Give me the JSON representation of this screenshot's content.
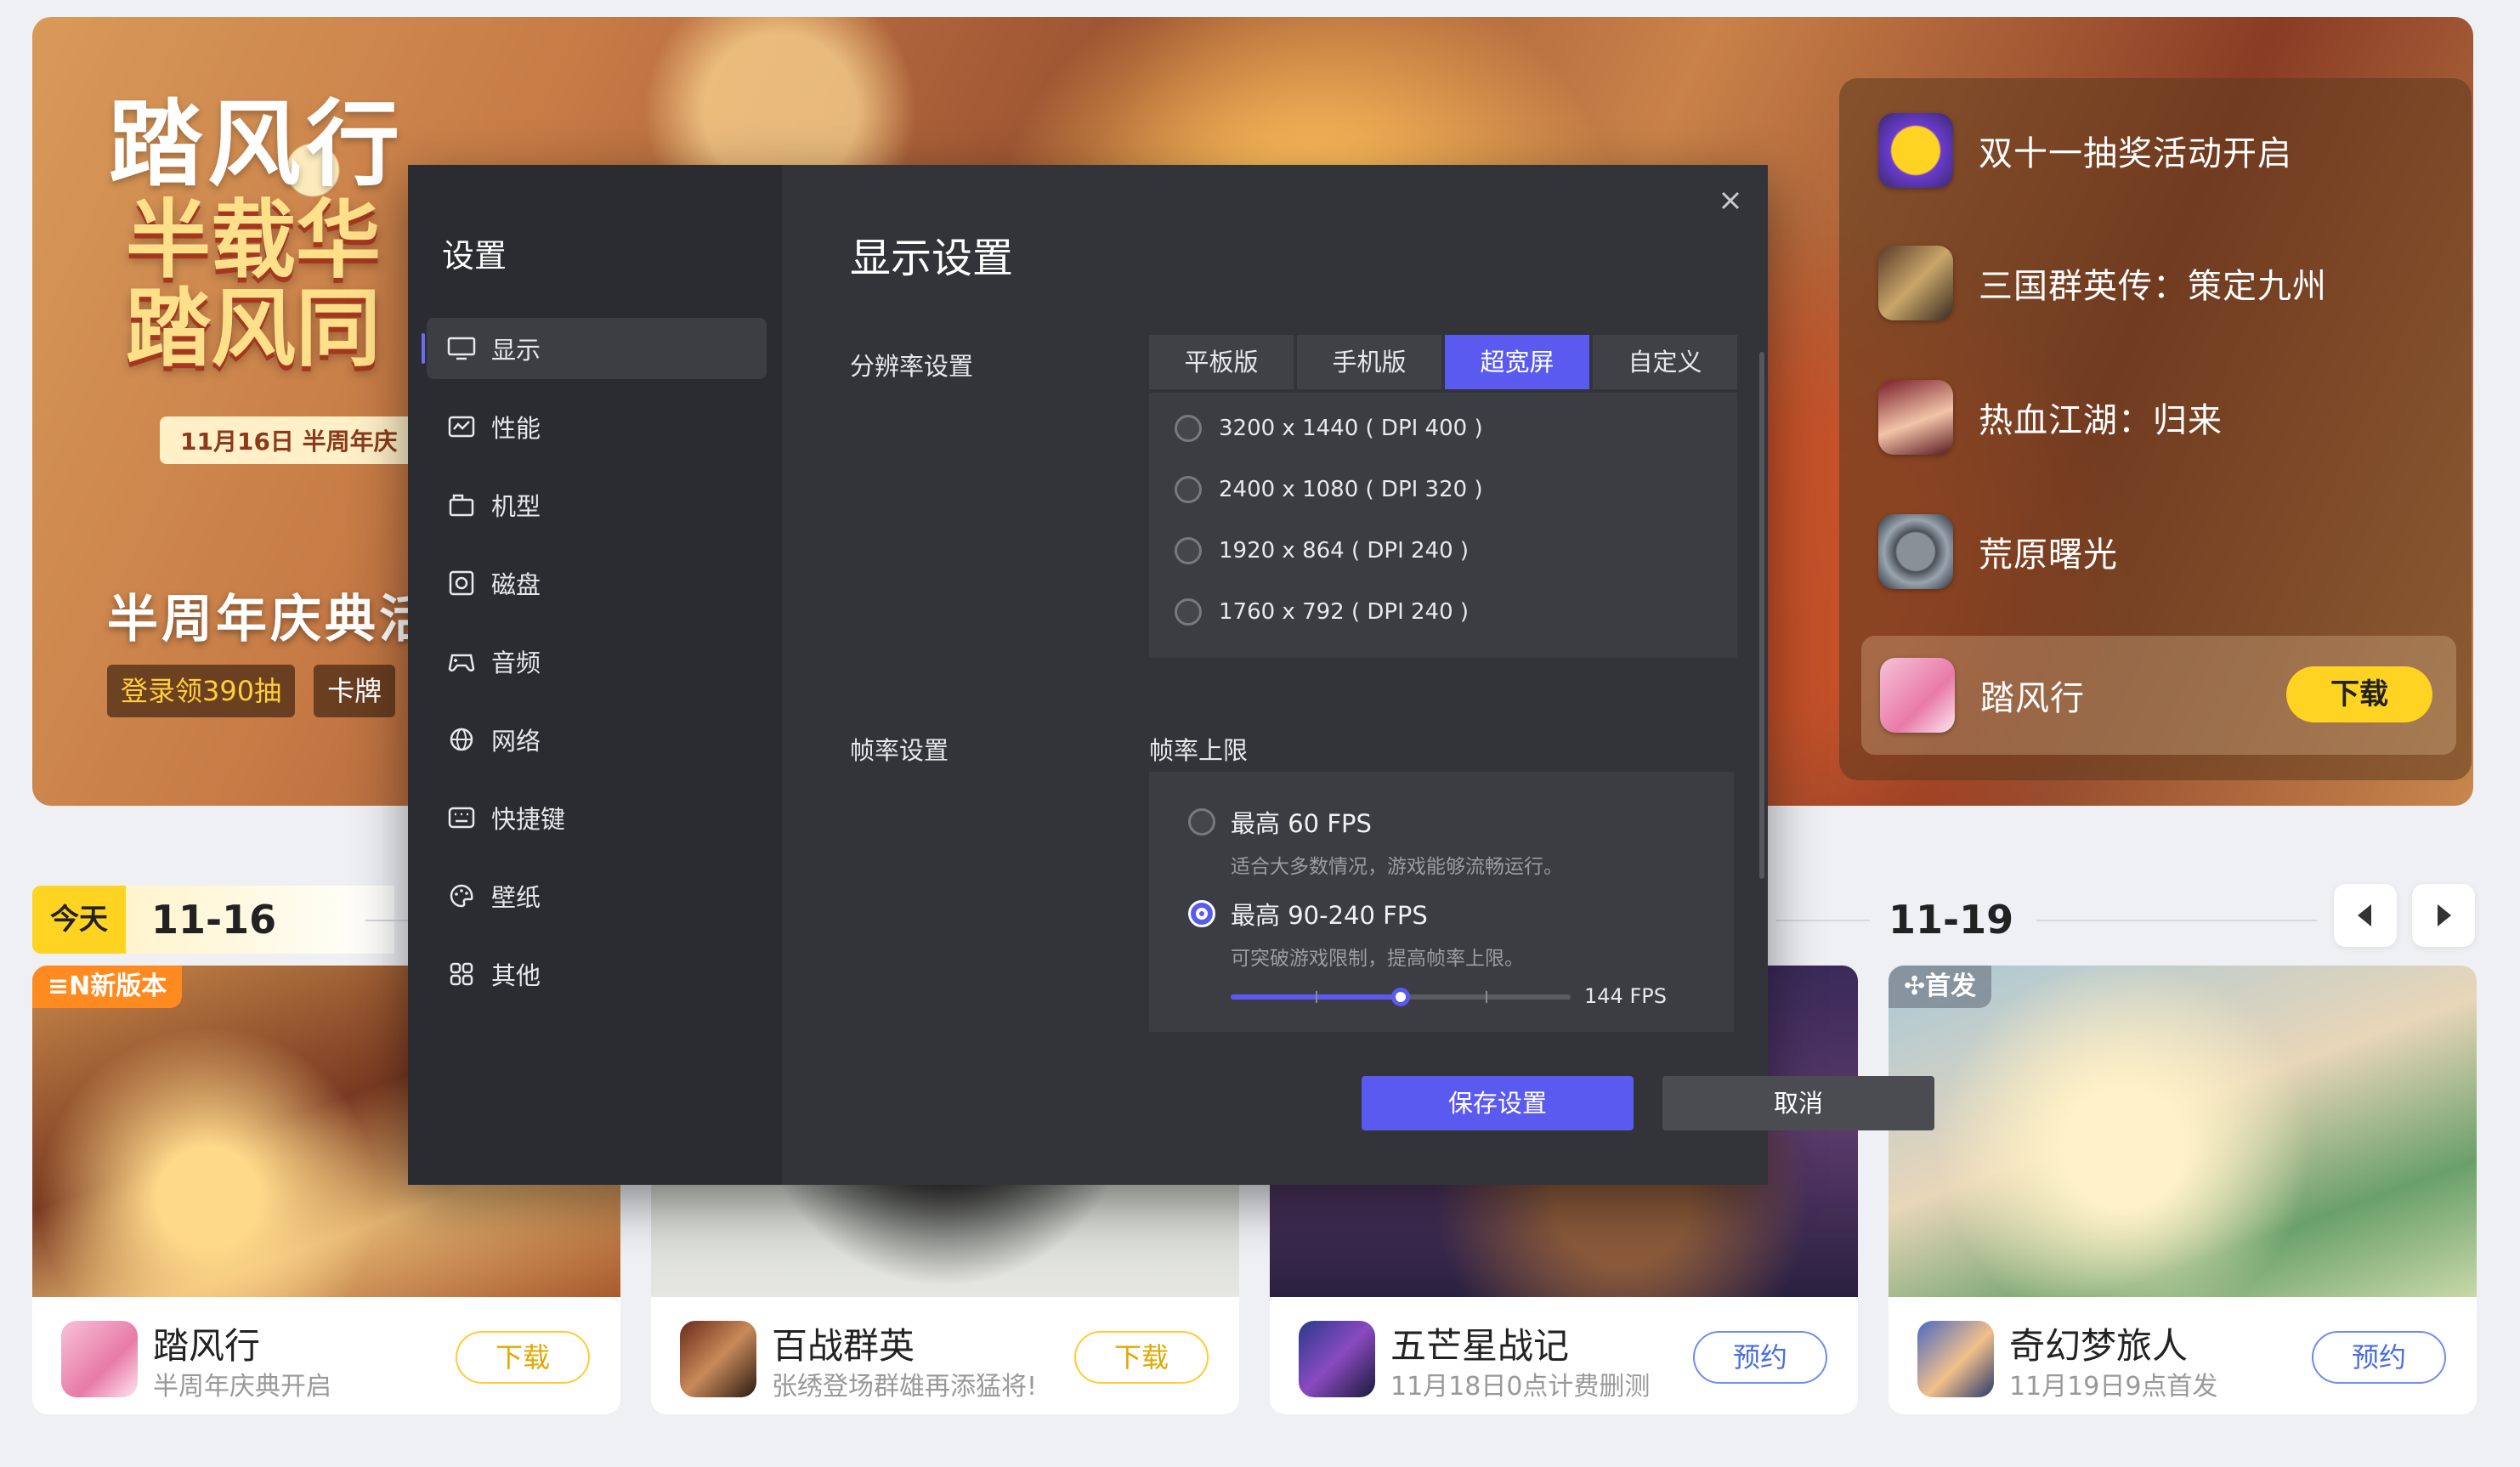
{
  "banner": {
    "logo_text": "踏风行",
    "slogan": "半载华 踏风同",
    "date_strip": "11月16日 半周年庆",
    "main_title": "半周年庆典活",
    "tags": [
      "登录领390抽",
      "卡牌"
    ]
  },
  "side_panel": {
    "items": [
      {
        "label": "双十一抽奖活动开启"
      },
      {
        "label": "三国群英传：策定九州"
      },
      {
        "label": "热血江湖：归来"
      },
      {
        "label": "荒原曙光"
      },
      {
        "label": "踏风行",
        "button": "下载"
      }
    ]
  },
  "date_row": {
    "today": "今天",
    "first_date": "11-16",
    "last_date": "11-19"
  },
  "cards": [
    {
      "badge": "≡N新版本",
      "name": "踏风行",
      "sub": "半周年庆典开启",
      "button": "下载"
    },
    {
      "badge": "",
      "name": "百战群英",
      "sub": "张绣登场群雄再添猛将!",
      "button": "下载"
    },
    {
      "badge": "",
      "name": "五芒星战记",
      "sub": "11月18日0点计费删测",
      "button": "预约"
    },
    {
      "badge": "✣首发",
      "name": "奇幻梦旅人",
      "sub": "11月19日9点首发",
      "button": "预约"
    }
  ],
  "settings": {
    "title": "设置",
    "menu": [
      {
        "label": "显示",
        "icon": "monitor-icon"
      },
      {
        "label": "性能",
        "icon": "performance-icon"
      },
      {
        "label": "机型",
        "icon": "device-model-icon"
      },
      {
        "label": "磁盘",
        "icon": "disk-icon"
      },
      {
        "label": "音频",
        "icon": "gamepad-icon"
      },
      {
        "label": "网络",
        "icon": "globe-icon"
      },
      {
        "label": "快捷键",
        "icon": "keyboard-icon"
      },
      {
        "label": "壁纸",
        "icon": "palette-icon"
      },
      {
        "label": "其他",
        "icon": "grid-icon"
      }
    ],
    "page_title": "显示设置",
    "resolution": {
      "label": "分辨率设置",
      "tabs": [
        "平板版",
        "手机版",
        "超宽屏",
        "自定义"
      ],
      "active_tab": "超宽屏",
      "options": [
        "3200 x 1440 ( DPI 400 )",
        "2400 x 1080 ( DPI 320 )",
        "1920 x 864 ( DPI 240 )",
        "1760 x 792 ( DPI 240 )"
      ]
    },
    "framerate": {
      "label": "帧率设置",
      "sublabel": "帧率上限",
      "options": [
        {
          "title": "最高 60 FPS",
          "desc": "适合大多数情况，游戏能够流畅运行。",
          "selected": false
        },
        {
          "title": "最高 90-240 FPS",
          "desc": "可突破游戏限制，提高帧率上限。",
          "selected": true
        }
      ],
      "slider_value": "144 FPS",
      "slider_fraction": 0.5
    },
    "save_button": "保存设置",
    "cancel_button": "取消"
  },
  "colors": {
    "accent": "#5a5af0",
    "download_yellow": "#ffd321",
    "modal_side": "#2a2c31",
    "modal_main": "#323439"
  }
}
